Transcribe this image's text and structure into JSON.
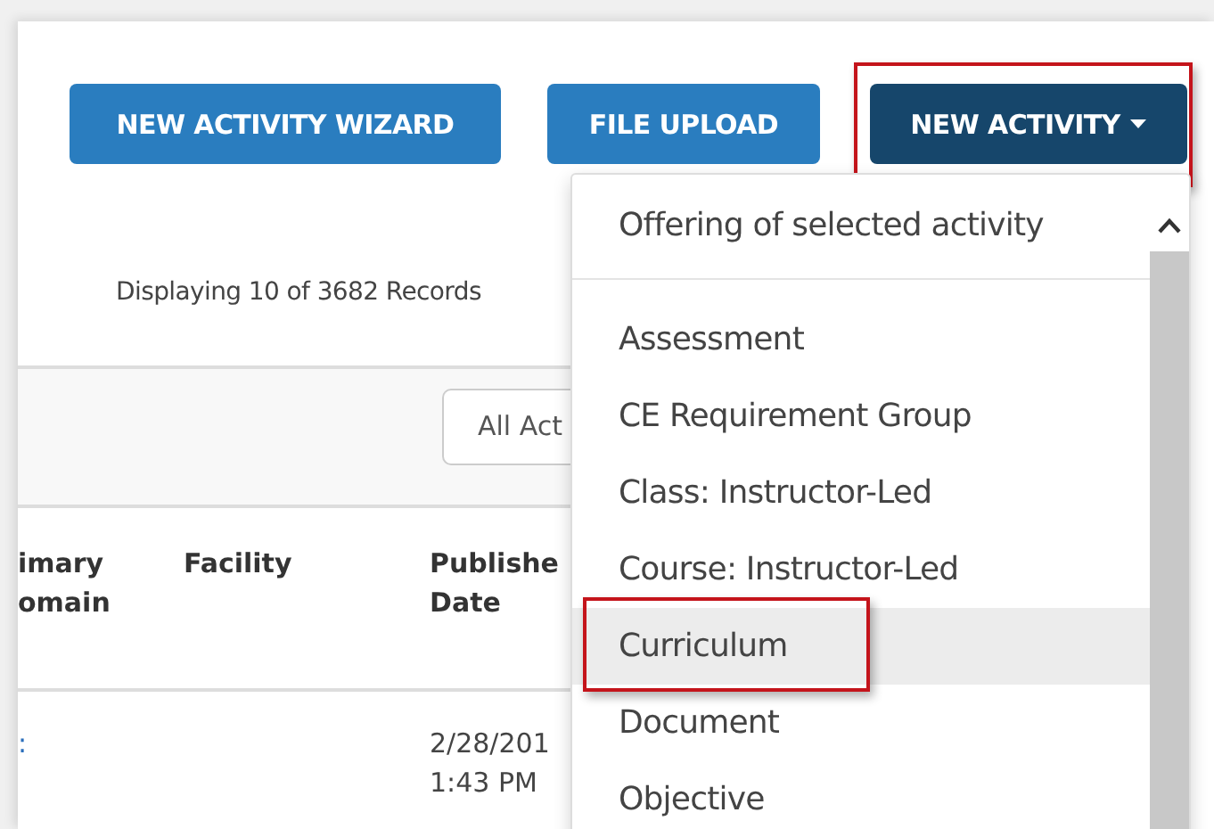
{
  "buttons": [
    {
      "label": "NEW ACTIVITY WIZARD",
      "kind": "plain",
      "highlighted": false
    },
    {
      "label": "FILE UPLOAD",
      "kind": "plain",
      "highlighted": false
    },
    {
      "label": "NEW ACTIVITY",
      "kind": "dropdown",
      "highlighted": true
    }
  ],
  "record_count": "Displaying 10 of 3682 Records",
  "filter": {
    "value": "All Act"
  },
  "table": {
    "columns": [
      {
        "lines": [
          "imary",
          "omain"
        ]
      },
      {
        "lines": [
          "Facility"
        ]
      },
      {
        "lines": [
          "Publishe",
          "Date"
        ]
      }
    ],
    "rows": [
      {
        "cells": [
          {
            "text": ":",
            "kind": "link"
          },
          {
            "text": ""
          },
          {
            "text": "2/28/201\n1:43 PM",
            "kind": "text"
          }
        ]
      }
    ]
  },
  "menu": {
    "header": "Offering of selected activity",
    "items": [
      {
        "label": "Assessment",
        "selected": false,
        "highlighted": false
      },
      {
        "label": "CE Requirement Group",
        "selected": false,
        "highlighted": false
      },
      {
        "label": "Class: Instructor-Led",
        "selected": false,
        "highlighted": false
      },
      {
        "label": "Course: Instructor-Led",
        "selected": false,
        "highlighted": false
      },
      {
        "label": "Curriculum",
        "selected": true,
        "highlighted": true
      },
      {
        "label": "Document",
        "selected": false,
        "highlighted": false
      },
      {
        "label": "Objective",
        "selected": false,
        "highlighted": false
      }
    ]
  }
}
